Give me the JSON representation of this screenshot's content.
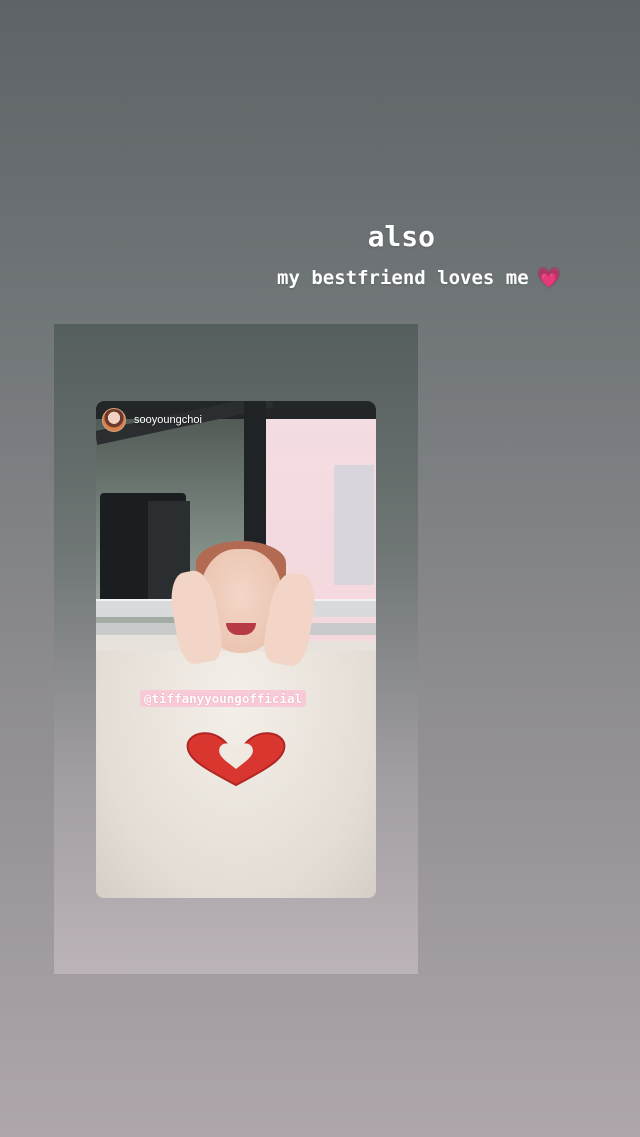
{
  "caption": {
    "title": "also",
    "line": "my bestfriend loves me",
    "emoji": "💗"
  },
  "shared_post": {
    "username": "sooyoungchoi",
    "mention": "@tiffanyyoungofficial"
  },
  "colors": {
    "caption_text": "#ffffff",
    "mention_bg": "#f8c9d6",
    "heart": "#e0358c"
  }
}
